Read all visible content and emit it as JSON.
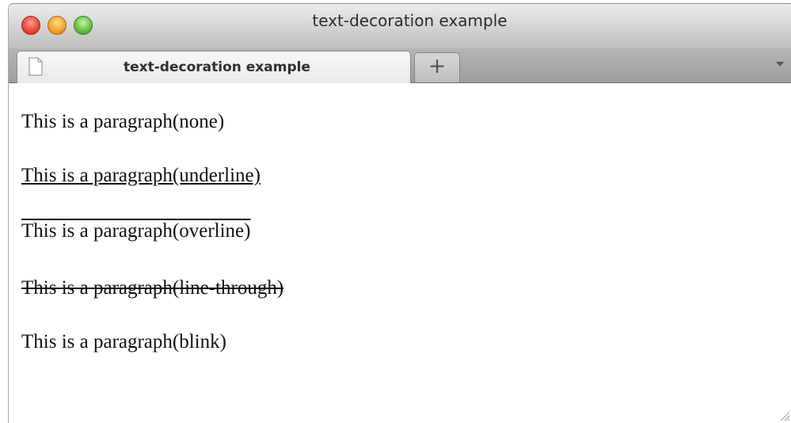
{
  "window": {
    "title": "text-decoration example"
  },
  "tabs": [
    {
      "label": "text-decoration example",
      "active": true
    }
  ],
  "new_tab_label": "+",
  "paragraphs": [
    {
      "text": "This is a paragraph(none)",
      "decoration": "none"
    },
    {
      "text": "This is a paragraph(underline)",
      "decoration": "underline"
    },
    {
      "text": "This is a paragraph(overline)",
      "decoration": "overline"
    },
    {
      "text": "This is a paragraph(line-through)",
      "decoration": "line-through"
    },
    {
      "text": "This is a paragraph(blink)",
      "decoration": "blink"
    }
  ],
  "icons": {
    "close": "close-icon",
    "minimize": "minimize-icon",
    "zoom": "zoom-icon",
    "tab": "document-icon",
    "tab_menu": "chevron-down-icon",
    "resize": "resize-grip-icon"
  },
  "colors": {
    "close": "#ea4b3e",
    "minimize": "#f2a632",
    "zoom": "#6cc14a",
    "text": "#111111"
  }
}
